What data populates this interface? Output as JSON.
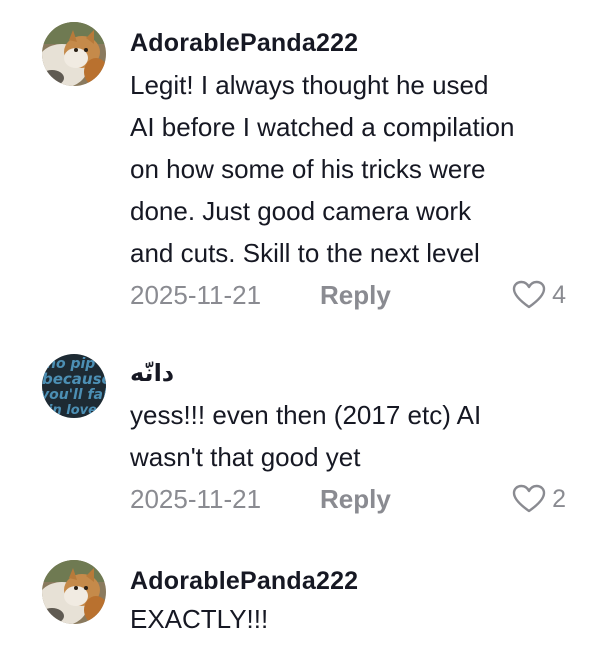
{
  "comments": [
    {
      "username": "AdorablePanda222",
      "text": "Legit! I always thought he used AI before I watched a compilation on how some of his tricks were done. Just good camera work and cuts. Skill to the next level",
      "lines": [
        "Legit! I always thought he used",
        "AI before I watched a compilation",
        "on how some of his tricks were",
        "done. Just good camera work",
        "and cuts. Skill to the next level"
      ],
      "timestamp": "2025-11-21",
      "reply_label": "Reply",
      "likes": "4",
      "avatar": "cat-photo-avatar"
    },
    {
      "username": "دانّه",
      "text": "yess!!! even then (2017 etc) AI wasn't that good yet",
      "lines": [
        "yess!!! even then (2017 etc) AI",
        "wasn't that good yet"
      ],
      "timestamp": "2025-11-21",
      "reply_label": "Reply",
      "likes": "2",
      "avatar": "text-art-avatar",
      "avatar_text": [
        "no pip",
        "because",
        "you'll fall",
        "in love"
      ]
    },
    {
      "username": "AdorablePanda222",
      "text": "EXACTLY!!!",
      "lines": [
        "EXACTLY!!!"
      ],
      "avatar": "cat-photo-avatar"
    }
  ],
  "colors": {
    "text_primary": "#161823",
    "text_secondary": "#8a8b91",
    "background": "#ffffff"
  }
}
